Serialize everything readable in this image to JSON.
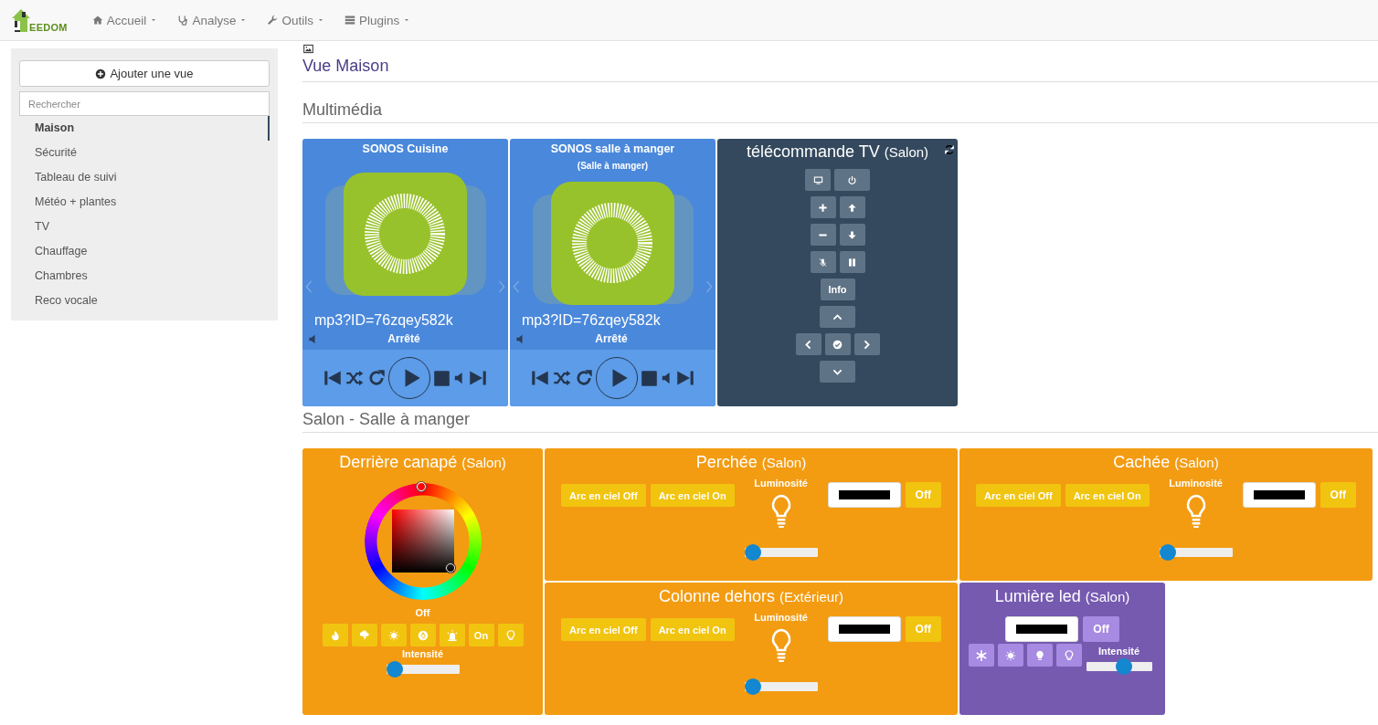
{
  "navbar": {
    "logo_text": "EEDOM",
    "menus": [
      {
        "label": "Accueil"
      },
      {
        "label": "Analyse"
      },
      {
        "label": "Outils"
      },
      {
        "label": "Plugins"
      }
    ]
  },
  "sidebar": {
    "add_button": "Ajouter une vue",
    "search": {
      "placeholder": "Rechercher"
    },
    "items": [
      {
        "label": "Maison",
        "selected": true
      },
      {
        "label": "Sécurité",
        "selected": false
      },
      {
        "label": "Tableau de suivi",
        "selected": false
      },
      {
        "label": "Météo + plantes",
        "selected": false
      },
      {
        "label": "TV",
        "selected": false
      },
      {
        "label": "Chauffage",
        "selected": false
      },
      {
        "label": "Chambres",
        "selected": false
      },
      {
        "label": "Reco vocale",
        "selected": false
      }
    ]
  },
  "view": {
    "title": "Vue Maison",
    "sections": [
      {
        "title": "Multimédia",
        "widgets": [
          {
            "kind": "sonos",
            "name": "SONOS Cuisine",
            "track": "mp3?ID=76zqey582k",
            "status": "Arrêté"
          },
          {
            "kind": "sonos",
            "name": "SONOS salle à manger",
            "room": "(Salle à manger)",
            "track": "mp3?ID=76zqey582k",
            "status": "Arrêté"
          },
          {
            "kind": "remote",
            "name": "télécommande TV",
            "room": "(Salon)",
            "info_button": "Info"
          }
        ]
      },
      {
        "title": "Salon - Salle à manger",
        "widgets": [
          {
            "kind": "color_wheel",
            "name": "Derrière canapé",
            "room": "(Salon)",
            "state": "Off",
            "on_button": "On",
            "intensity_label": "Intensité",
            "level": 0
          },
          {
            "kind": "rgb",
            "name": "Perchée",
            "room": "(Salon)",
            "buttons": [
              "Arc en ciel Off",
              "Arc en ciel On"
            ],
            "brightness_label": "Luminosité",
            "off_button": "Off",
            "level": 0
          },
          {
            "kind": "rgb",
            "name": "Cachée",
            "room": "(Salon)",
            "buttons": [
              "Arc en ciel Off",
              "Arc en ciel On"
            ],
            "brightness_label": "Luminosité",
            "off_button": "Off",
            "level": 0
          },
          {
            "kind": "rgb",
            "name": "Colonne dehors",
            "room": "(Extérieur)",
            "buttons": [
              "Arc en ciel Off",
              "Arc en ciel On"
            ],
            "brightness_label": "Luminosité",
            "off_button": "Off",
            "level": 0
          },
          {
            "kind": "led",
            "name": "Lumière led",
            "room": "(Salon)",
            "off_button": "Off",
            "intensity_label": "Intensité",
            "level": 0.6
          }
        ]
      }
    ]
  }
}
